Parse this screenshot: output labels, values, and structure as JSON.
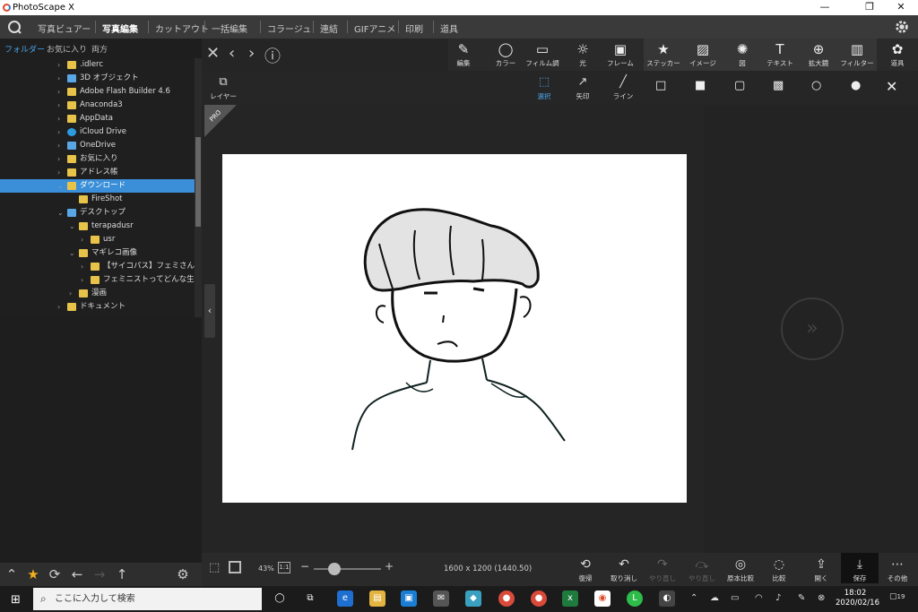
{
  "window": {
    "title": "PhotoScape X",
    "minimize": "—",
    "restore": "❐",
    "close": "✕"
  },
  "menu": [
    {
      "label": "写真ビュアー",
      "active": false
    },
    {
      "label": "写真編集",
      "active": true
    },
    {
      "label": "カットアウト",
      "active": false
    },
    {
      "label": "一括編集",
      "active": false
    },
    {
      "label": "コラージュ",
      "active": false
    },
    {
      "label": "連結",
      "active": false
    },
    {
      "label": "GIFアニメ",
      "active": false
    },
    {
      "label": "印刷",
      "active": false
    },
    {
      "label": "道具",
      "active": false
    }
  ],
  "left_tabs": [
    "フォルダー",
    "お気に入り",
    "両方"
  ],
  "tree": [
    {
      "label": ".idlerc",
      "indent": 1,
      "chev": "›",
      "icon": "folder"
    },
    {
      "label": "3D オブジェクト",
      "indent": 1,
      "chev": "›",
      "icon": "folder-blue"
    },
    {
      "label": "Adobe Flash Builder 4.6",
      "indent": 1,
      "chev": "›",
      "icon": "folder"
    },
    {
      "label": "Anaconda3",
      "indent": 1,
      "chev": "›",
      "icon": "folder"
    },
    {
      "label": "AppData",
      "indent": 1,
      "chev": "›",
      "icon": "folder"
    },
    {
      "label": "iCloud Drive",
      "indent": 1,
      "chev": "›",
      "icon": "cloud"
    },
    {
      "label": "OneDrive",
      "indent": 1,
      "chev": "›",
      "icon": "folder-blue"
    },
    {
      "label": "お気に入り",
      "indent": 1,
      "chev": "›",
      "icon": "folder"
    },
    {
      "label": "アドレス帳",
      "indent": 1,
      "chev": "›",
      "icon": "folder"
    },
    {
      "label": "ダウンロード",
      "indent": 1,
      "chev": "⌄",
      "icon": "folder",
      "selected": true
    },
    {
      "label": "FireShot",
      "indent": 2,
      "chev": "",
      "icon": "folder"
    },
    {
      "label": "デスクトップ",
      "indent": 1,
      "chev": "⌄",
      "icon": "folder-blue"
    },
    {
      "label": "terapadusr",
      "indent": 2,
      "chev": "⌄",
      "icon": "folder"
    },
    {
      "label": "usr",
      "indent": 3,
      "chev": "›",
      "icon": "folder"
    },
    {
      "label": "マギレコ画像",
      "indent": 2,
      "chev": "⌄",
      "icon": "folder"
    },
    {
      "label": "【サイコパス】フェミさん、宇崎ち",
      "indent": 3,
      "chev": "›",
      "icon": "folder"
    },
    {
      "label": "フェミニストってどんな生き物？",
      "indent": 3,
      "chev": "›",
      "icon": "folder"
    },
    {
      "label": "漫画",
      "indent": 2,
      "chev": "›",
      "icon": "folder"
    },
    {
      "label": "ドキュメント",
      "indent": 1,
      "chev": "›",
      "icon": "folder"
    }
  ],
  "top_controls": {
    "close": "✕",
    "prev": "‹",
    "next": "›",
    "info": "ⓘ"
  },
  "tools": [
    {
      "label": "編集",
      "glyph": "✎",
      "icon": "edit-icon"
    },
    {
      "label": "カラー",
      "glyph": "◯",
      "icon": "color-icon"
    },
    {
      "label": "フィルム調",
      "glyph": "▭",
      "icon": "film-icon"
    },
    {
      "label": "光",
      "glyph": "☼",
      "icon": "light-icon"
    },
    {
      "label": "フレーム",
      "glyph": "▣",
      "icon": "frame-icon"
    },
    {
      "label": "ステッカー",
      "glyph": "★",
      "icon": "sticker-icon"
    },
    {
      "label": "イメージ",
      "glyph": "▨",
      "icon": "image-icon"
    },
    {
      "label": "図",
      "glyph": "✺",
      "icon": "shape-icon"
    },
    {
      "label": "テキスト",
      "glyph": "T",
      "icon": "text-icon"
    },
    {
      "label": "拡大鏡",
      "glyph": "⊕",
      "icon": "magnifier-icon"
    },
    {
      "label": "フィルター",
      "glyph": "▥",
      "icon": "filter-icon"
    },
    {
      "label": "道具",
      "glyph": "✿",
      "icon": "tools-icon"
    }
  ],
  "layer_label": "レイヤー",
  "subtools": [
    {
      "label": "選択",
      "glyph": "⬚",
      "selected": true,
      "icon": "select-icon"
    },
    {
      "label": "矢印",
      "glyph": "↗",
      "selected": false,
      "icon": "arrow-icon"
    },
    {
      "label": "ライン",
      "glyph": "╱",
      "selected": false,
      "icon": "line-icon"
    }
  ],
  "shapes": [
    "□",
    "■",
    "▢",
    "▩",
    "○",
    "●"
  ],
  "close_sub": "✕",
  "pro_badge": "PRO",
  "bottom": {
    "zoom": "43%",
    "one_to_one": "1:1",
    "zoom_level": 0.3,
    "dimensions": "1600 x 1200 (1440.50)",
    "actions": [
      {
        "label": "復帰",
        "glyph": "⟲",
        "disabled": false,
        "icon": "revert-icon"
      },
      {
        "label": "取り消し",
        "glyph": "↶",
        "disabled": false,
        "icon": "undo-icon"
      },
      {
        "label": "やり直し",
        "glyph": "↷",
        "disabled": true,
        "icon": "redo-icon"
      },
      {
        "label": "やり直し",
        "glyph": "⤼",
        "disabled": true,
        "icon": "redo-all-icon"
      },
      {
        "label": "原本比較",
        "glyph": "◎",
        "disabled": false,
        "icon": "compare-original-icon"
      },
      {
        "label": "比較",
        "glyph": "◌",
        "disabled": false,
        "icon": "compare-icon"
      },
      {
        "label": "開く",
        "glyph": "⇪",
        "disabled": false,
        "icon": "open-icon"
      },
      {
        "label": "保存",
        "glyph": "⤓",
        "disabled": false,
        "icon": "save-icon",
        "save": true
      },
      {
        "label": "その他",
        "glyph": "⋯",
        "disabled": false,
        "icon": "more-icon"
      }
    ]
  },
  "taskbar": {
    "search_placeholder": "ここに入力して検索",
    "time": "18:02",
    "date": "2020/02/16",
    "notifications": "19"
  },
  "colors": {
    "accent": "#3a8fd8",
    "app_bg": "#202020"
  }
}
